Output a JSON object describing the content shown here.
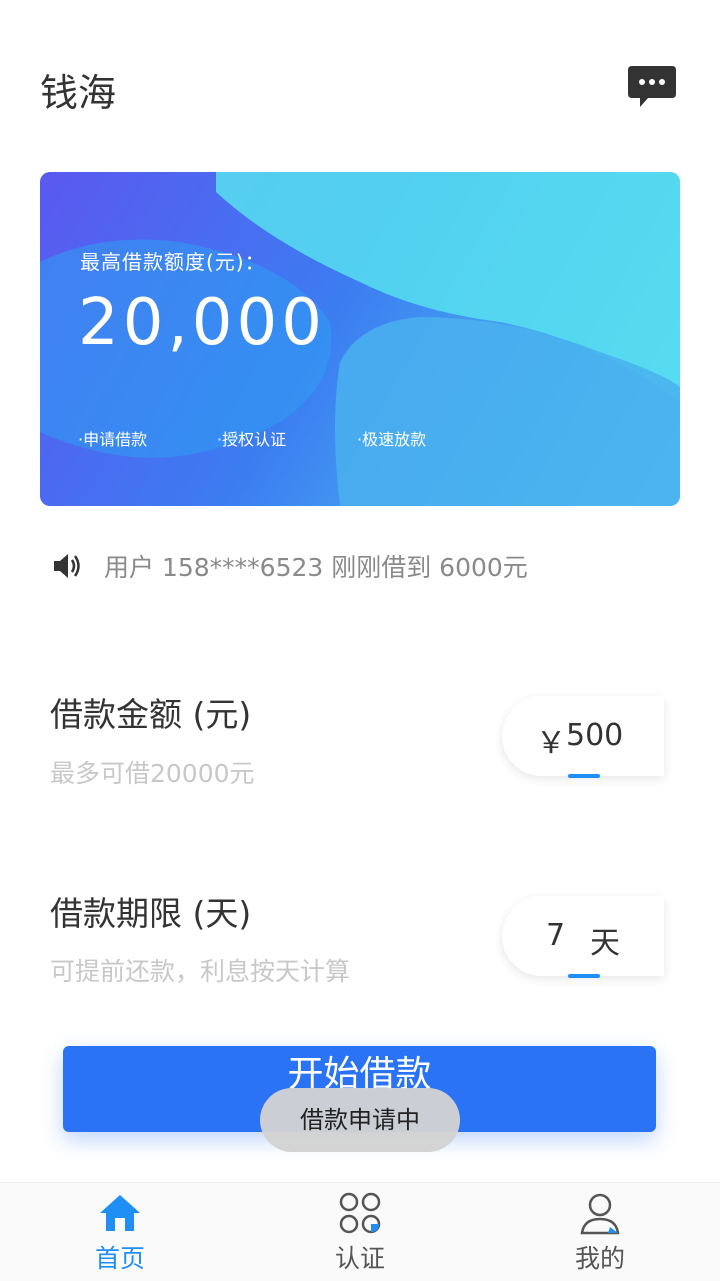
{
  "header": {
    "title": "钱海",
    "message_icon": "chat-bubble-icon"
  },
  "banner": {
    "label": "最高借款额度(元)：",
    "amount": "20,000",
    "steps": [
      "·申请借款",
      "·授权认证",
      "·极速放款"
    ]
  },
  "notice": {
    "icon": "speaker-icon",
    "text": "用户 158****6523 刚刚借到 6000元"
  },
  "loan_amount": {
    "title": "借款金额 (元)",
    "subtitle": "最多可借20000元",
    "currency": "￥",
    "value": "500"
  },
  "loan_term": {
    "title": "借款期限 (天)",
    "subtitle": "可提前还款，利息按天计算",
    "value": "7",
    "unit": "天"
  },
  "cta": {
    "label": "开始借款"
  },
  "toast": {
    "text": "借款申请中"
  },
  "tabbar": {
    "items": [
      {
        "label": "首页",
        "icon": "home-icon",
        "active": true
      },
      {
        "label": "认证",
        "icon": "certify-icon",
        "active": false
      },
      {
        "label": "我的",
        "icon": "profile-icon",
        "active": false
      }
    ]
  },
  "colors": {
    "accent": "#2a73f5",
    "active_tab": "#1f8ff5"
  }
}
